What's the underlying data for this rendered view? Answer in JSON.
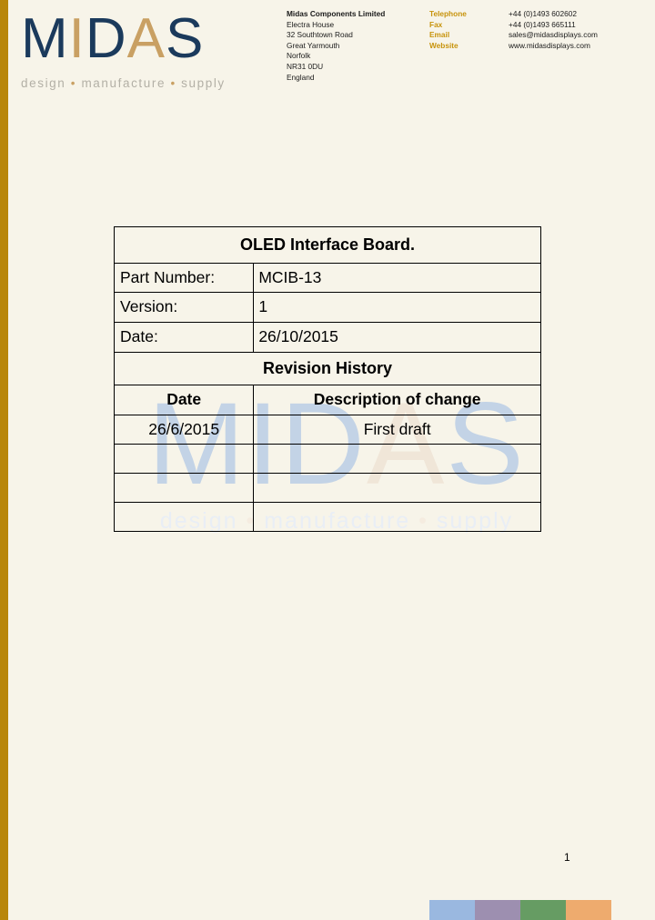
{
  "document": {
    "page_number": "1"
  },
  "brand": {
    "logo_letters": [
      {
        "char": "M",
        "color": "#1b3a5c"
      },
      {
        "char": "I",
        "color": "#c9a063"
      },
      {
        "char": "D",
        "color": "#1b3a5c"
      },
      {
        "char": "A",
        "color": "#c9a063"
      },
      {
        "char": "S",
        "color": "#1b3a5c"
      }
    ],
    "tagline_words": [
      "design",
      "manufacture",
      "supply"
    ],
    "tagline_separator": "•",
    "navy": "#1b3a5c",
    "gold": "#c9a063",
    "edge_bar_color": "#b8860b"
  },
  "header": {
    "address": [
      "Midas Components Limited",
      "Electra House",
      "32 Southtown Road",
      "Great Yarmouth",
      "Norfolk",
      "NR31 0DU",
      "England"
    ],
    "contact_labels": [
      "Telephone",
      "Fax",
      "Email",
      "Website"
    ],
    "contact_values": [
      "+44 (0)1493 602602",
      "+44 (0)1493 665111",
      "sales@midasdisplays.com",
      "www.midasdisplays.com"
    ],
    "label_color": "#c7930c"
  },
  "main_table": {
    "title": "OLED Interface Board.",
    "fields": [
      {
        "label": "Part Number:",
        "value": "MCIB-13"
      },
      {
        "label": "Version:",
        "value": "1"
      },
      {
        "label": "Date:",
        "value": "26/10/2015"
      }
    ],
    "revision_section_title": "Revision History",
    "revision_headers": [
      "Date",
      "Description of change"
    ],
    "revision_rows": [
      {
        "date": "26/6/2015",
        "description": "First draft"
      },
      {
        "date": "",
        "description": ""
      },
      {
        "date": "",
        "description": ""
      },
      {
        "date": "",
        "description": ""
      }
    ]
  },
  "footer": {
    "swatch_colors": [
      "#9ab8e0",
      "#9d8fb0",
      "#669c63",
      "#eeab6e"
    ]
  }
}
